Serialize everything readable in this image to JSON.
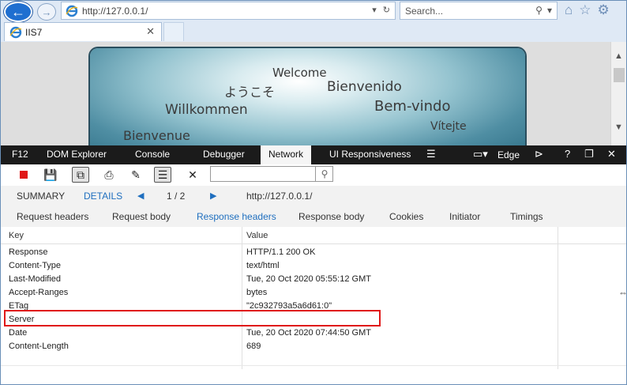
{
  "browser": {
    "url": "http://127.0.0.1/",
    "search_placeholder": "Search...",
    "tab_title": "IIS7"
  },
  "page": {
    "welcome_words": [
      {
        "text": "Welcome",
        "size": 15
      },
      {
        "text": "ようこそ",
        "size": 16
      },
      {
        "text": "Bienvenido",
        "size": 17
      },
      {
        "text": "Willkommen",
        "size": 17
      },
      {
        "text": "Bem-vindo",
        "size": 18
      },
      {
        "text": "Vítejte",
        "size": 14
      },
      {
        "text": "Bienvenue",
        "size": 16
      }
    ]
  },
  "devtools": {
    "tabs": [
      "F12",
      "DOM Explorer",
      "Console",
      "Debugger",
      "Network",
      "UI Responsiveness"
    ],
    "active_tab": "Network",
    "emulation": "Edge",
    "summary_label": "SUMMARY",
    "details_label": "DETAILS",
    "pager": "1 / 2",
    "request_url": "http://127.0.0.1/",
    "subtabs": [
      "Request headers",
      "Request body",
      "Response headers",
      "Response body",
      "Cookies",
      "Initiator",
      "Timings"
    ],
    "active_subtab": "Response headers",
    "columns": {
      "key": "Key",
      "value": "Value"
    },
    "rows": [
      {
        "key": "Response",
        "value": "HTTP/1.1 200 OK"
      },
      {
        "key": "Content-Type",
        "value": "text/html"
      },
      {
        "key": "Last-Modified",
        "value": "Tue, 20 Oct 2020 05:55:12 GMT"
      },
      {
        "key": "Accept-Ranges",
        "value": "bytes"
      },
      {
        "key": "ETag",
        "value": "\"2c932793a5a6d61:0\""
      },
      {
        "key": "Server",
        "value": ""
      },
      {
        "key": "Date",
        "value": "Tue, 20 Oct 2020 07:44:50 GMT"
      },
      {
        "key": "Content-Length",
        "value": "689"
      }
    ]
  },
  "colors": {
    "accent_blue": "#1f6fbf",
    "highlight": "#e01818",
    "devtools_bar": "#1b1b1b"
  }
}
